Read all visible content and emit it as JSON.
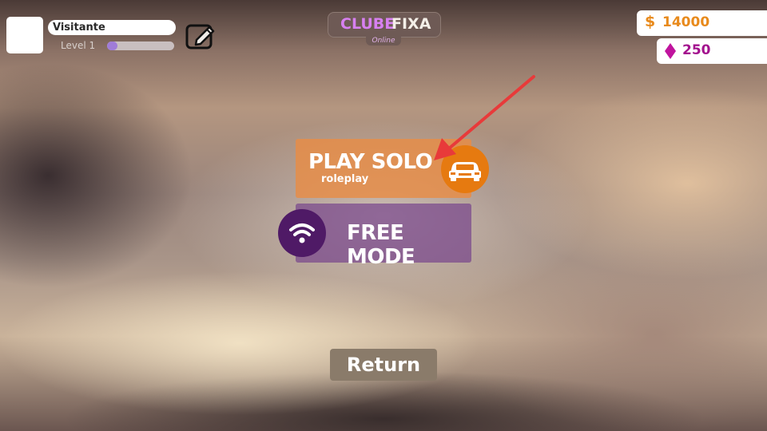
{
  "player": {
    "name": "Visitante",
    "level_label": "Level 1",
    "xp_fraction": 0.15
  },
  "logo": {
    "part1": "CLUBE",
    "part2": "FIXA",
    "subtitle": "Online"
  },
  "currency": {
    "cash_symbol": "$",
    "cash": "14000",
    "gems": "250",
    "cash_color": "#e88a1c",
    "gems_color": "#a3128e"
  },
  "menu": {
    "play_solo_title": "PLAY SOLO",
    "play_solo_subtitle": "roleplay",
    "free_mode_title": "FREE MODE",
    "return_label": "Return"
  },
  "icons": {
    "edit": "edit-icon",
    "car": "car-icon",
    "wifi": "wifi-icon",
    "gem": "diamond-icon"
  },
  "colors": {
    "play_solo": "#e88c46",
    "free_mode": "#784690",
    "annotation_arrow": "#e83a3a"
  }
}
